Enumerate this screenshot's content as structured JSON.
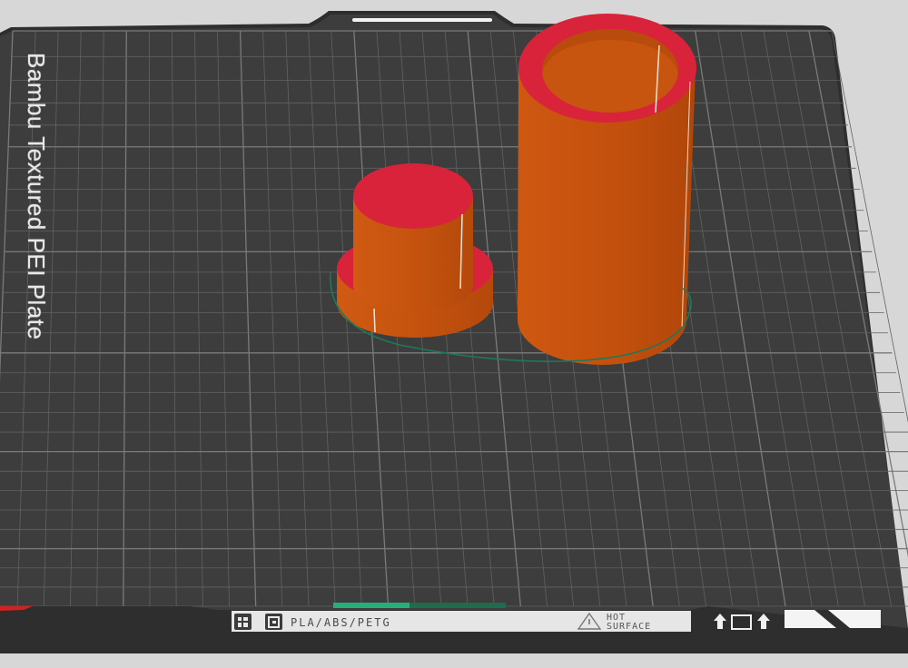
{
  "plate": {
    "title": "Bambu Textured PEI Plate",
    "bed_materials": "PLA/ABS/PETG",
    "warning_line1": "HOT",
    "warning_line2": "SURFACE"
  },
  "icons": {
    "left_badge": "grid-icon",
    "second_badge": "bambu-logo-icon",
    "warning": "warning-triangle-icon",
    "up_arrow_left": "arrow-up-icon",
    "square": "square-icon",
    "up_arrow_right": "arrow-up-icon",
    "origin_marker": "x-axis-arrow-icon"
  },
  "colors": {
    "plate": "#3d3d3d",
    "plate_frame": "#2f2f2f",
    "grid": "#6a6a6a",
    "object_side": "#c8540f",
    "object_top": "#d8233a",
    "outline": "#1a7a5a",
    "accent_green": "#22a86a"
  },
  "objects": [
    {
      "name": "stepped-cylinder",
      "kind": "step"
    },
    {
      "name": "hollow-tube",
      "kind": "tube"
    }
  ]
}
